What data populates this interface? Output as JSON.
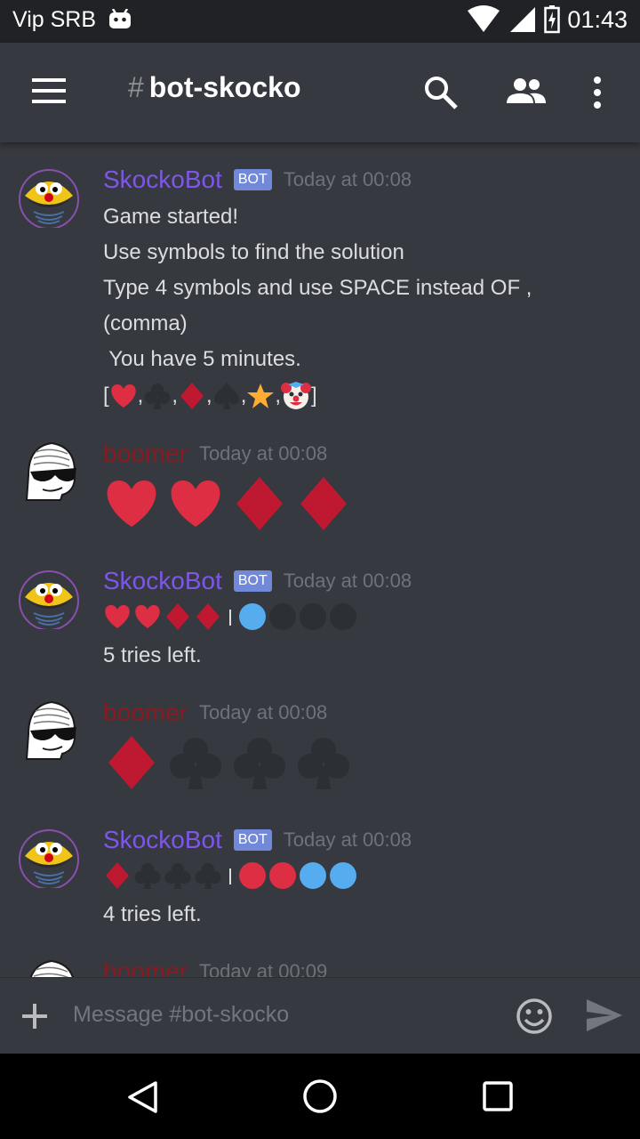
{
  "status_bar": {
    "carrier": "Vip SRB",
    "time": "01:43"
  },
  "channel": {
    "name": "bot-skocko"
  },
  "messages": [
    {
      "author": "SkockoBot",
      "badge": "BOT",
      "timestamp": "Today at 00:08",
      "lines": [
        "Game started!",
        "Use symbols to find the solution",
        "Type 4 symbols and use SPACE instead OF ,",
        "(comma)",
        " You have 5 minutes."
      ]
    },
    {
      "author": "boomer",
      "timestamp": "Today at 00:08"
    },
    {
      "author": "SkockoBot",
      "badge": "BOT",
      "timestamp": "Today at 00:08",
      "text": "5 tries left."
    },
    {
      "author": "boomer",
      "timestamp": "Today at 00:08"
    },
    {
      "author": "SkockoBot",
      "badge": "BOT",
      "timestamp": "Today at 00:08",
      "text": "4 tries left."
    },
    {
      "author": "boomer",
      "timestamp": "Today at 00:09"
    }
  ],
  "composer": {
    "placeholder": "Message #bot-skocko"
  },
  "game": {
    "symbols_legend": [
      "heart",
      "club",
      "diamond",
      "spade",
      "star",
      "clown"
    ],
    "guesses": [
      {
        "symbols": [
          "heart",
          "heart",
          "diamond",
          "diamond"
        ],
        "result": [
          "blue",
          "empty",
          "empty",
          "empty"
        ]
      },
      {
        "symbols": [
          "diamond",
          "club",
          "club",
          "club"
        ],
        "result": [
          "red",
          "red",
          "blue",
          "blue"
        ]
      }
    ]
  },
  "colors": {
    "bot_name": "#7e57e8",
    "user_name": "#8b1a1f",
    "bot_badge": "#7289da",
    "heart": "#dd2e44",
    "diamond": "#be1931",
    "blue_peg": "#55acee",
    "red_peg": "#dd2e44"
  }
}
